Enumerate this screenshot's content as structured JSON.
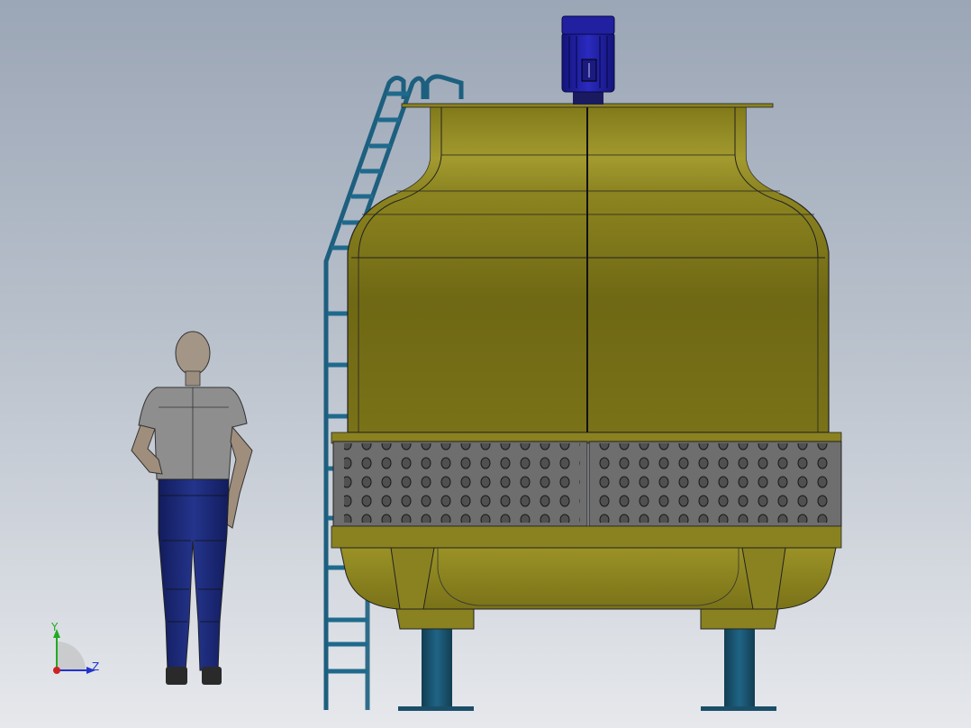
{
  "viewport": {
    "background_top": "#9ba6b6",
    "background_bottom": "#e6e8ec"
  },
  "model": {
    "colors": {
      "tower_body": "#7a7218",
      "tower_highlight": "#a59d2e",
      "tower_shadow": "#5e5810",
      "louver_panel": "#6e6e6e",
      "louver_hole": "#3a3a3a",
      "ladder": "#1d5f7e",
      "motor": "#1e1e9e",
      "legs": "#1c5c7a",
      "human_shirt": "#8e8e8e",
      "human_pants": "#1b2a7a",
      "human_skin": "#a89888",
      "human_shoes": "#2a2a2a"
    },
    "icons": [
      "motor-icon",
      "ladder-icon",
      "human-figure-icon",
      "coordinate-triad-icon"
    ]
  },
  "triad": {
    "y_label": "Y",
    "z_label": "Z",
    "y_color": "#22aa22",
    "z_color": "#2233cc",
    "origin_color": "#cc2222"
  }
}
